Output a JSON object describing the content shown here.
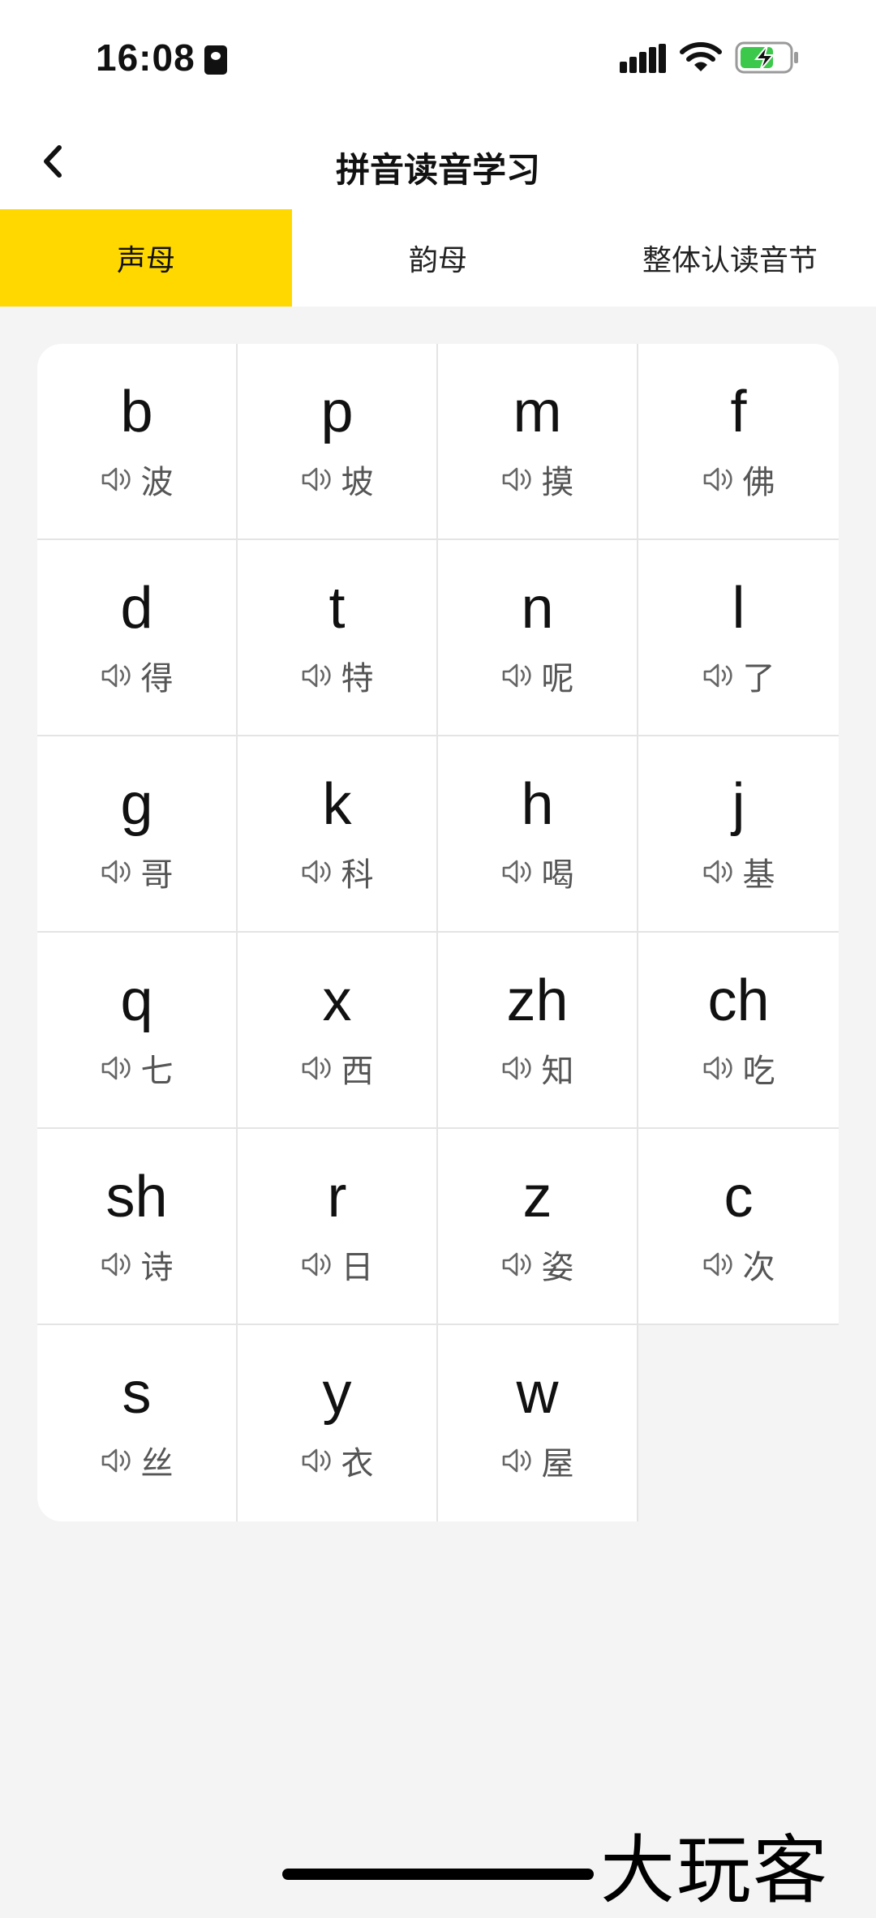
{
  "status_bar": {
    "time": "16:08"
  },
  "nav": {
    "title": "拼音读音学习"
  },
  "tabs": [
    {
      "label": "声母",
      "active": true
    },
    {
      "label": "韵母",
      "active": false
    },
    {
      "label": "整体认读音节",
      "active": false
    }
  ],
  "items": [
    {
      "pinyin": "b",
      "char": "波"
    },
    {
      "pinyin": "p",
      "char": "坡"
    },
    {
      "pinyin": "m",
      "char": "摸"
    },
    {
      "pinyin": "f",
      "char": "佛"
    },
    {
      "pinyin": "d",
      "char": "得"
    },
    {
      "pinyin": "t",
      "char": "特"
    },
    {
      "pinyin": "n",
      "char": "呢"
    },
    {
      "pinyin": "l",
      "char": "了"
    },
    {
      "pinyin": "g",
      "char": "哥"
    },
    {
      "pinyin": "k",
      "char": "科"
    },
    {
      "pinyin": "h",
      "char": "喝"
    },
    {
      "pinyin": "j",
      "char": "基"
    },
    {
      "pinyin": "q",
      "char": "七"
    },
    {
      "pinyin": "x",
      "char": "西"
    },
    {
      "pinyin": "zh",
      "char": "知"
    },
    {
      "pinyin": "ch",
      "char": "吃"
    },
    {
      "pinyin": "sh",
      "char": "诗"
    },
    {
      "pinyin": "r",
      "char": "日"
    },
    {
      "pinyin": "z",
      "char": "姿"
    },
    {
      "pinyin": "c",
      "char": "次"
    },
    {
      "pinyin": "s",
      "char": "丝"
    },
    {
      "pinyin": "y",
      "char": "衣"
    },
    {
      "pinyin": "w",
      "char": "屋"
    }
  ],
  "icons": {
    "speaker": "speaker-icon",
    "back": "chevron-left-icon"
  },
  "colors": {
    "accent": "#ffd800",
    "battery": "#3cc84a"
  },
  "watermark": "大玩客"
}
